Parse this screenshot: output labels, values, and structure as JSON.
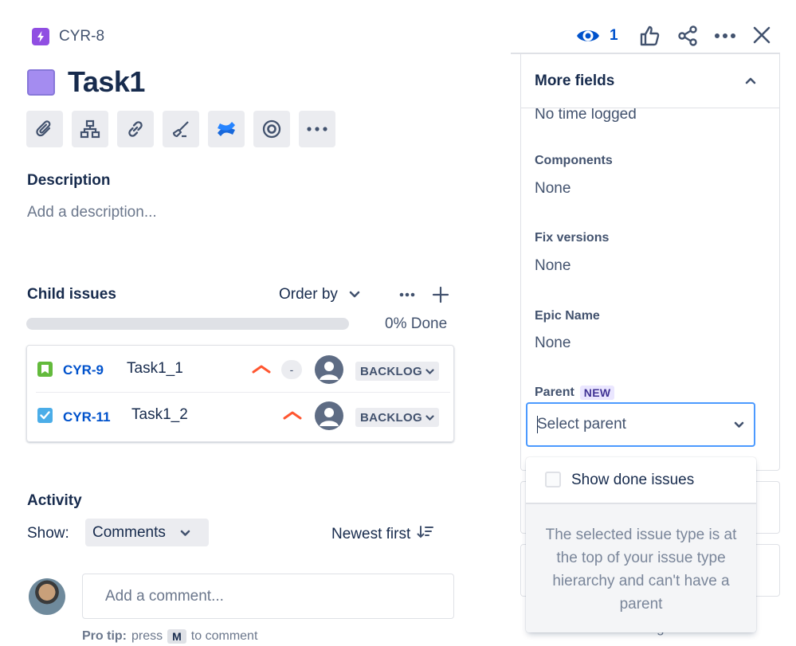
{
  "header": {
    "issue_key": "CYR-8",
    "watch_count": "1",
    "issue_title": "Task1"
  },
  "description": {
    "heading": "Description",
    "placeholder": "Add a description..."
  },
  "child_issues": {
    "heading": "Child issues",
    "order_by_label": "Order by",
    "progress_percent": 0,
    "progress_text": "0% Done",
    "rows": [
      {
        "key": "CYR-9",
        "summary": "Task1_1",
        "type": "story",
        "type_color": "#63ba3c",
        "priority": "high",
        "estimate": "-",
        "status": "BACKLOG"
      },
      {
        "key": "CYR-11",
        "summary": "Task1_2",
        "type": "task",
        "type_color": "#4bade8",
        "priority": "high",
        "status": "BACKLOG"
      }
    ]
  },
  "activity": {
    "heading": "Activity",
    "show_label": "Show:",
    "filter_value": "Comments",
    "sort_label": "Newest first",
    "comment_placeholder": "Add a comment...",
    "protip_prefix": "Pro tip:",
    "protip_press": "press",
    "protip_key": "M",
    "protip_suffix": "to comment"
  },
  "panel": {
    "section_title": "More fields",
    "time_tracking_value": "No time logged",
    "fields": [
      {
        "label": "Components",
        "value": "None"
      },
      {
        "label": "Fix versions",
        "value": "None"
      },
      {
        "label": "Epic Name",
        "value": "None"
      }
    ],
    "parent": {
      "label": "Parent",
      "badge": "NEW",
      "placeholder": "Select parent"
    },
    "dropdown": {
      "checkbox_label": "Show done issues",
      "message": "The selected issue type is at the top of your issue type hierarchy and can't have a parent"
    },
    "footer_text": "Created 3 minutes ago"
  },
  "colors": {
    "accent": "#0052cc",
    "priority_high": "#ff5630",
    "epic_purple": "#904ee2",
    "focus_border": "#4c9aff"
  }
}
